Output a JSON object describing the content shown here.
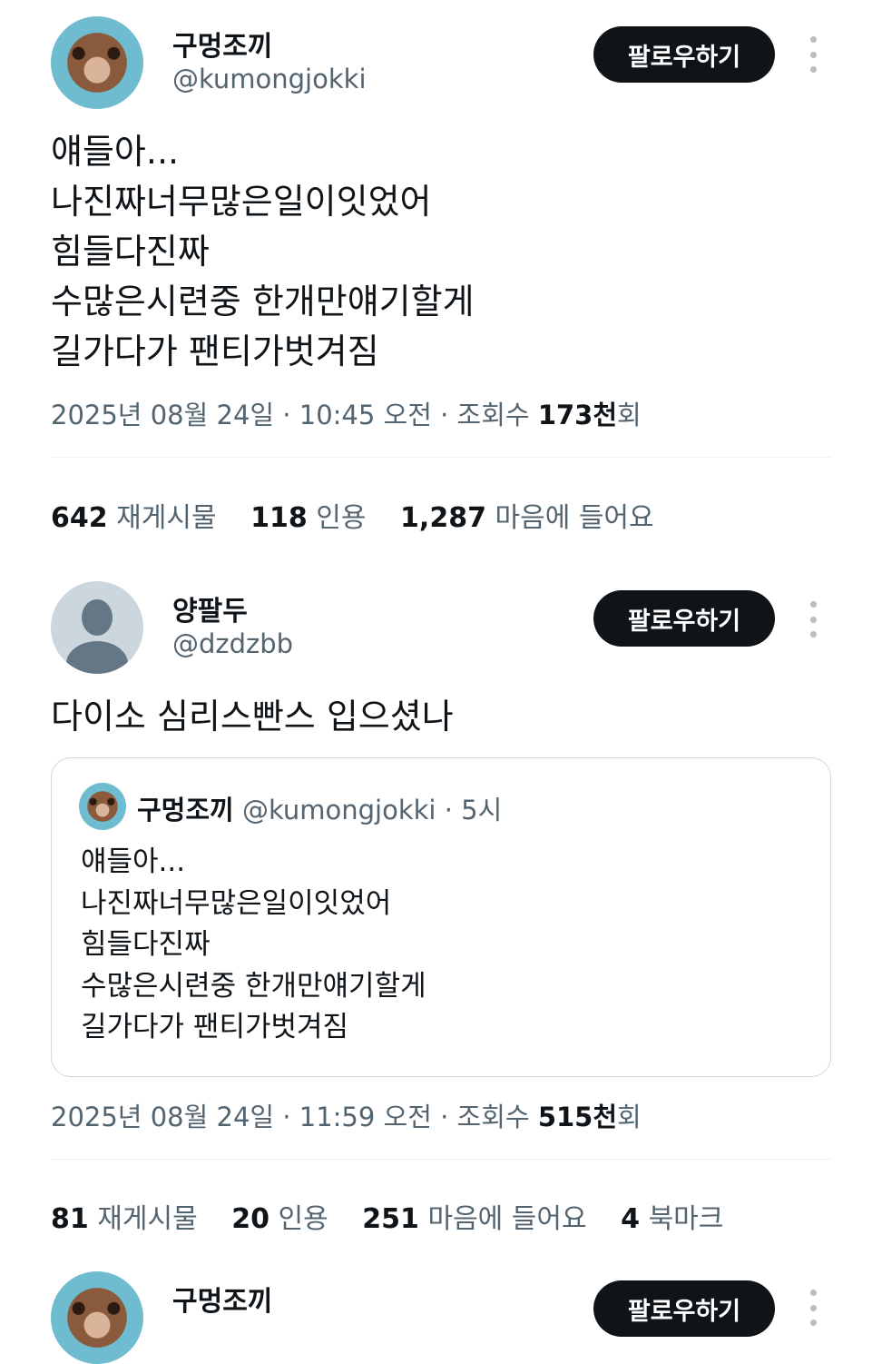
{
  "tweets": [
    {
      "name": "구멍조끼",
      "handle": "@kumongjokki",
      "follow_label": "팔로우하기",
      "text": "얘들아...\n나진짜너무많은일이잇었어\n힘들다진짜\n수많은시련중 한개만얘기할게\n길가다가 팬티가벗겨짐",
      "meta_prefix": "2025년 08월 24일 · 10:45 오전 · 조회수 ",
      "views": "173천",
      "meta_suffix": "회",
      "stats": [
        {
          "count": "642",
          "label": "재게시물"
        },
        {
          "count": "118",
          "label": "인용"
        },
        {
          "count": "1,287",
          "label": "마음에 들어요"
        }
      ]
    },
    {
      "name": "양팔두",
      "handle": "@dzdzbb",
      "follow_label": "팔로우하기",
      "text": "다이소 심리스빤스 입으셨나",
      "quote": {
        "name": "구멍조끼",
        "handle": "@kumongjokki",
        "time": "· 5시",
        "text": "얘들아...\n나진짜너무많은일이잇었어\n힘들다진짜\n수많은시련중 한개만얘기할게\n길가다가 팬티가벗겨짐"
      },
      "meta_prefix": "2025년 08월 24일 · 11:59 오전 · 조회수 ",
      "views": "515천",
      "meta_suffix": "회",
      "stats": [
        {
          "count": "81",
          "label": "재게시물"
        },
        {
          "count": "20",
          "label": "인용"
        },
        {
          "count": "251",
          "label": "마음에 들어요"
        },
        {
          "count": "4",
          "label": "북마크"
        }
      ]
    },
    {
      "name": "구멍조끼",
      "follow_label": "팔로우하기"
    }
  ]
}
